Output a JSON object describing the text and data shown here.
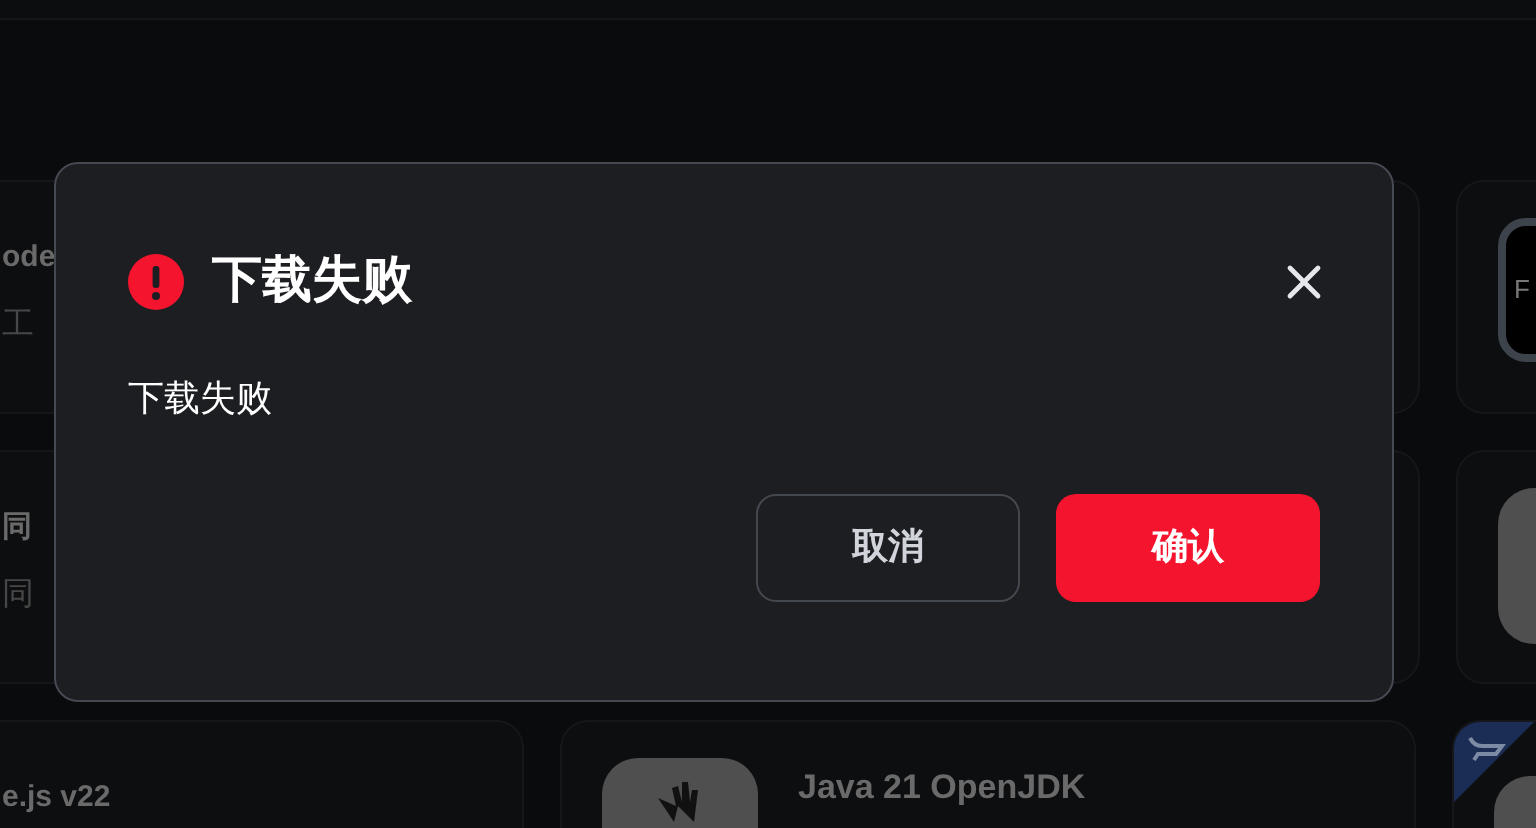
{
  "background": {
    "rows": [
      {
        "cards": [
          {
            "kind": "text",
            "title": "ode",
            "subtitle": "工"
          },
          {
            "kind": "terminal-app",
            "tile_text": "F"
          }
        ]
      },
      {
        "cards": [
          {
            "kind": "text",
            "title": "同",
            "subtitle": "同"
          },
          {
            "kind": "gray-app"
          }
        ]
      },
      {
        "cards": [
          {
            "kind": "text",
            "title": "e.js v22"
          },
          {
            "kind": "cursor-app",
            "title": "Java 21 OpenJDK"
          },
          {
            "kind": "gray-app",
            "badge": true
          }
        ]
      }
    ]
  },
  "dialog": {
    "title": "下载失败",
    "message": "下载失败",
    "buttons": [
      {
        "label": "取消",
        "kind": "secondary"
      },
      {
        "label": "确认",
        "kind": "primary"
      }
    ]
  }
}
